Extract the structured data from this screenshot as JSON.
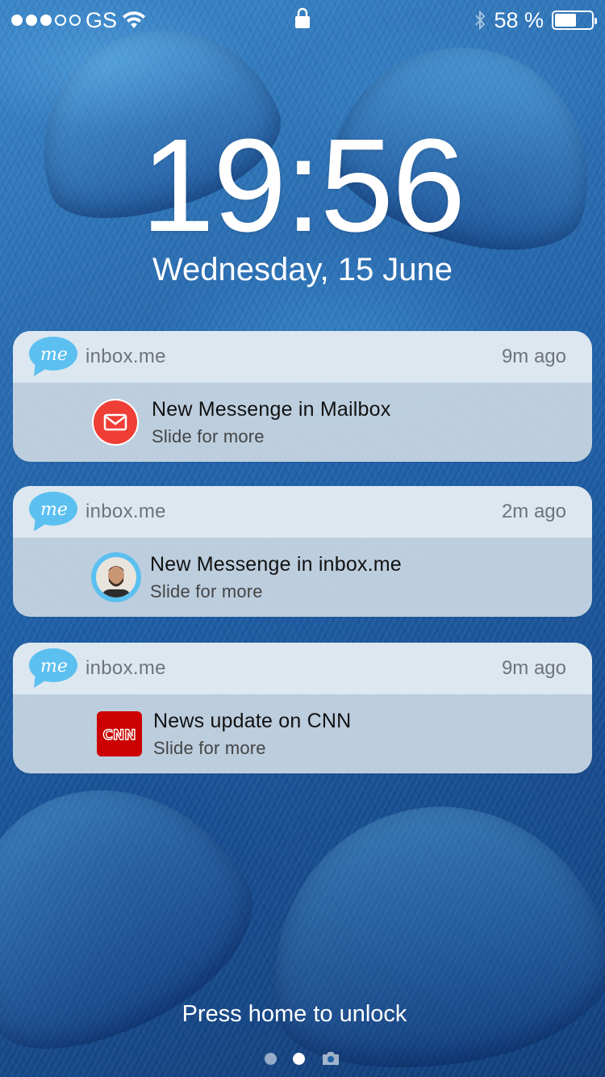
{
  "status_bar": {
    "carrier": "GS",
    "signal_bars_filled": 3,
    "signal_bars_total": 5,
    "battery_percent": "58 %",
    "battery_level": 0.58
  },
  "lock_screen": {
    "time": "19:56",
    "date": "Wednesday, 15 June",
    "unlock_hint": "Press home to unlock"
  },
  "notifications": [
    {
      "app_name": "inbox.me",
      "app_icon_text": "me",
      "time": "9m ago",
      "title": "New Messenge in Mailbox",
      "subtitle": "Slide for more",
      "sender_icon": "mail-icon"
    },
    {
      "app_name": "inbox.me",
      "app_icon_text": "me",
      "time": "2m ago",
      "title": "New Messenge in inbox.me",
      "subtitle": "Slide for more",
      "sender_icon": "avatar"
    },
    {
      "app_name": "inbox.me",
      "app_icon_text": "me",
      "time": "9m ago",
      "title": "News update on CNN",
      "subtitle": "Slide for more",
      "sender_icon": "cnn-logo",
      "sender_icon_text": "CNN"
    }
  ],
  "colors": {
    "app_icon_blue": "#5bc0f0",
    "mail_red": "#ef3e36",
    "cnn_red": "#cc0000"
  }
}
